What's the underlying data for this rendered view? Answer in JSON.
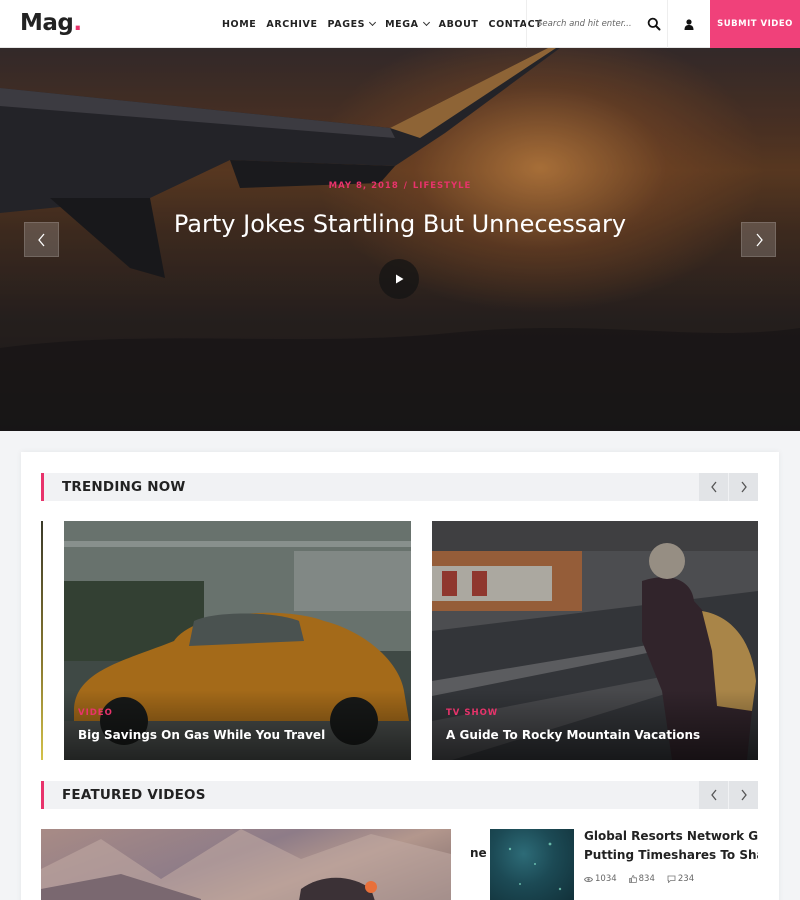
{
  "header": {
    "logo_text": "Mag",
    "logo_dot": ".",
    "nav": [
      {
        "label": "HOME"
      },
      {
        "label": "ARCHIVE"
      },
      {
        "label": "PAGES",
        "has_dropdown": true
      },
      {
        "label": "MEGA",
        "has_dropdown": true
      },
      {
        "label": "ABOUT"
      },
      {
        "label": "CONTACT"
      }
    ],
    "search_placeholder": "Search and hit enter...",
    "search_icon": "search-icon",
    "user_icon": "user-icon",
    "submit_label": "SUBMIT VIDEO",
    "accent_color": "#f0417a"
  },
  "hero": {
    "date": "MAY 8, 2018",
    "separator": "/",
    "category": "LIFESTYLE",
    "title": "Party Jokes Startling But Unnecessary",
    "play_icon": "play-icon",
    "prev_icon": "chevron-left-icon",
    "next_icon": "chevron-right-icon"
  },
  "trending": {
    "title": "TRENDING NOW",
    "cards": [
      {
        "category": "VIDEO",
        "title": "Big Savings On Gas While You Travel"
      },
      {
        "category": "TV SHOW",
        "title": "A Guide To Rocky Mountain Vacations"
      }
    ]
  },
  "featured": {
    "title": "FEATURED VIDEOS",
    "cut_text": "ne",
    "side_item": {
      "title_line1": "Global Resorts Network Grn",
      "title_line2": "Putting Timeshares To Shan",
      "views": "1034",
      "likes": "834",
      "comments": "234"
    }
  }
}
